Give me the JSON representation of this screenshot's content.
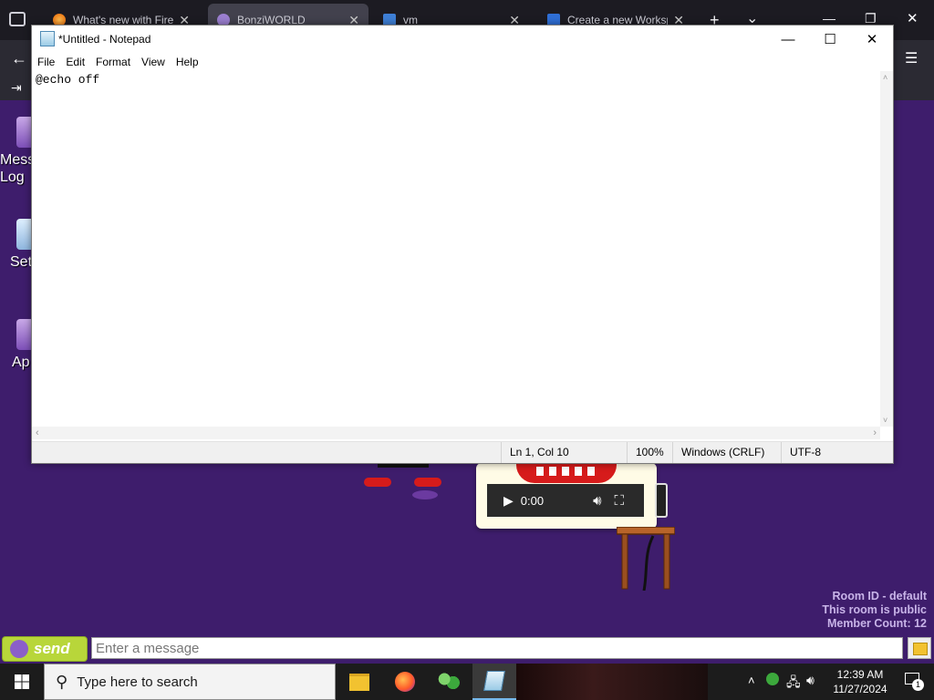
{
  "browser": {
    "tabs": [
      {
        "label": "What's new with Firefo",
        "active": false
      },
      {
        "label": "BonziWORLD",
        "active": true
      },
      {
        "label": "vm",
        "active": false
      },
      {
        "label": "Create a new Workspa",
        "active": false
      }
    ],
    "new_tab": "+",
    "tab_list": "⌄",
    "window_controls": {
      "minimize": "—",
      "restore": "❐",
      "close": "✕"
    }
  },
  "desktop_icons": [
    {
      "label": "Mess\nLog"
    },
    {
      "label": "Set"
    },
    {
      "label": "Ap"
    }
  ],
  "room": {
    "room_id": "Room ID - default",
    "visibility": "This room is public",
    "member_count": "Member Count: 12"
  },
  "video": {
    "time": "0:00"
  },
  "chat": {
    "send_label": "send",
    "placeholder": "Enter a message"
  },
  "notepad": {
    "title": "*Untitled - Notepad",
    "menu": [
      "File",
      "Edit",
      "Format",
      "View",
      "Help"
    ],
    "content": "@echo off",
    "status": {
      "position": "Ln 1, Col 10",
      "zoom": "100%",
      "line_ending": "Windows (CRLF)",
      "encoding": "UTF-8"
    }
  },
  "taskbar": {
    "search_placeholder": "Type here to search",
    "clock_time": "12:39 AM",
    "clock_date": "11/27/2024",
    "notification_count": "1"
  },
  "colors": {
    "page_bg": "#3e1d6c",
    "send_button": "#b8d63a",
    "taskbar": "#1c1c1c"
  }
}
